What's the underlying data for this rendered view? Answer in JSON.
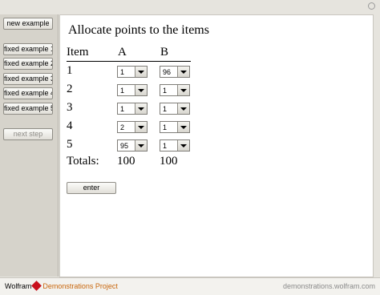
{
  "sidebar": {
    "new_example": "new example",
    "fixed": [
      "fixed example 1",
      "fixed example 2",
      "fixed example 3",
      "fixed example 4",
      "fixed example 5"
    ],
    "next_step": "next step"
  },
  "main": {
    "title": "Allocate points to the items",
    "headers": {
      "item": "Item",
      "a": "A",
      "b": "B"
    },
    "rows": [
      {
        "item": "1",
        "a": "1",
        "b": "96"
      },
      {
        "item": "2",
        "a": "1",
        "b": "1"
      },
      {
        "item": "3",
        "a": "1",
        "b": "1"
      },
      {
        "item": "4",
        "a": "2",
        "b": "1"
      },
      {
        "item": "5",
        "a": "95",
        "b": "1"
      }
    ],
    "totals": {
      "label": "Totals:",
      "a": "100",
      "b": "100"
    },
    "enter_label": "enter"
  },
  "footer": {
    "wolfram": "Wolfram",
    "demonstrations": "Demonstrations Project",
    "url": "demonstrations.wolfram.com"
  }
}
